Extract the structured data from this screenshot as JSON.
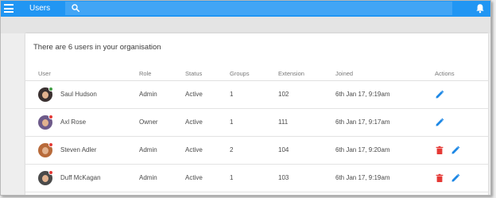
{
  "app": {
    "title": "Users"
  },
  "search": {
    "placeholder": "",
    "value": ""
  },
  "colors": {
    "primary": "#2196f3",
    "search_bg": "#42a5f5",
    "edit": "#1e88e5",
    "delete": "#e53935",
    "presence_online": "#43a047",
    "presence_busy": "#e53935"
  },
  "card": {
    "title": "There are 6 users in your organisation"
  },
  "columns": [
    "User",
    "Role",
    "Status",
    "Groups",
    "Extension",
    "Joined",
    "Actions"
  ],
  "users": [
    {
      "name": "Saul Hudson",
      "role": "Admin",
      "status": "Active",
      "groups": "1",
      "extension": "102",
      "joined": "6th Jan 17, 9:19am",
      "presence": "online",
      "can_delete": false,
      "avatar_color": "#3a3030"
    },
    {
      "name": "Axl Rose",
      "role": "Owner",
      "status": "Active",
      "groups": "1",
      "extension": "111",
      "joined": "6th Jan 17, 9:17am",
      "presence": "busy",
      "can_delete": false,
      "avatar_color": "#6d5a8a"
    },
    {
      "name": "Steven Adler",
      "role": "Admin",
      "status": "Active",
      "groups": "2",
      "extension": "104",
      "joined": "6th Jan 17, 9:20am",
      "presence": "busy",
      "can_delete": true,
      "avatar_color": "#b86a3a"
    },
    {
      "name": "Duff McKagan",
      "role": "Admin",
      "status": "Active",
      "groups": "1",
      "extension": "103",
      "joined": "6th Jan 17, 9:19am",
      "presence": "busy",
      "can_delete": true,
      "avatar_color": "#4a4a4a"
    }
  ],
  "icons": {
    "menu": "hamburger-icon",
    "search": "search-icon",
    "notifications": "bell-icon",
    "edit": "pencil-icon",
    "delete": "trash-icon"
  }
}
